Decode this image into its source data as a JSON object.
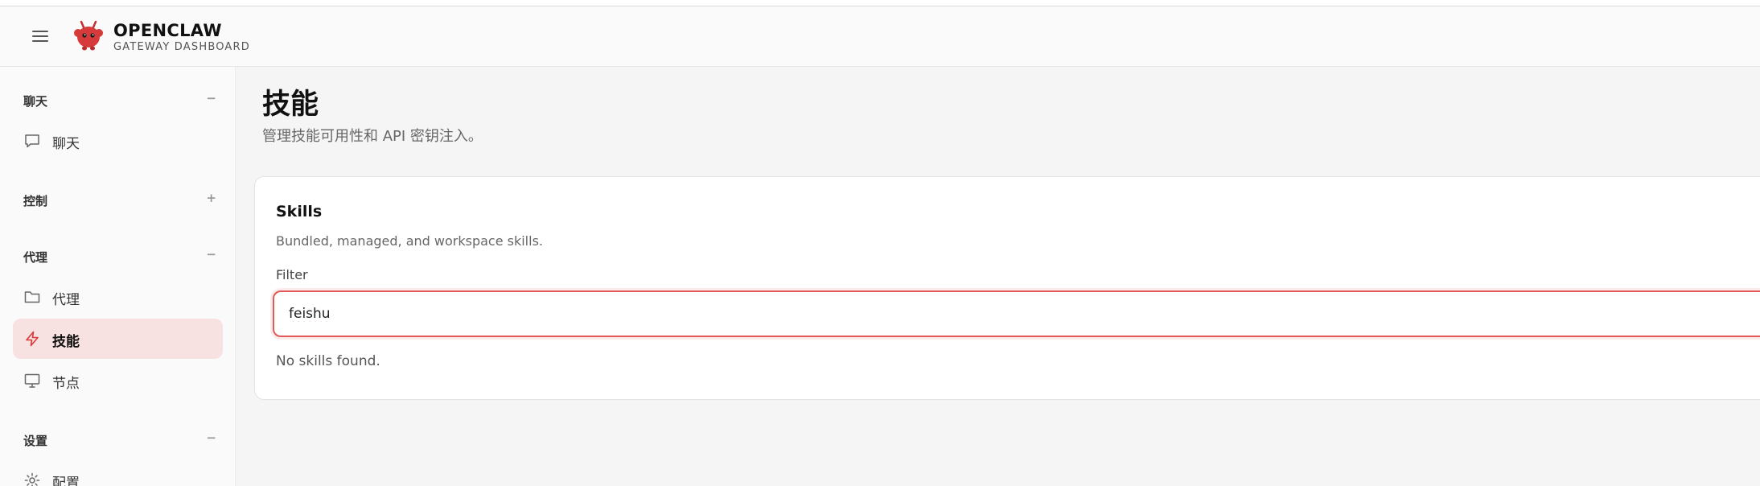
{
  "header": {
    "title": "OPENCLAW",
    "subtitle": "GATEWAY DASHBOARD"
  },
  "sidebar": {
    "groups": [
      {
        "label": "聊天",
        "toggle": "−",
        "items": [
          {
            "label": "聊天",
            "icon": "chat-icon"
          }
        ]
      },
      {
        "label": "控制",
        "toggle": "+",
        "items": []
      },
      {
        "label": "代理",
        "toggle": "−",
        "items": [
          {
            "label": "代理",
            "icon": "folder-icon"
          },
          {
            "label": "技能",
            "icon": "lightning-icon",
            "active": true
          },
          {
            "label": "节点",
            "icon": "monitor-icon"
          }
        ]
      },
      {
        "label": "设置",
        "toggle": "−",
        "items": [
          {
            "label": "配置",
            "icon": "gear-icon"
          }
        ]
      }
    ]
  },
  "main": {
    "title": "技能",
    "subtitle": "管理技能可用性和 API 密钥注入。",
    "card": {
      "title": "Skills",
      "subtitle": "Bundled, managed, and workspace skills.",
      "filter_label": "Filter",
      "filter_value": "feishu",
      "empty_message": "No skills found."
    }
  },
  "colors": {
    "accent": "#e05a5a",
    "active_bg": "#f8e1e1",
    "logo_red": "#d63a3a"
  }
}
